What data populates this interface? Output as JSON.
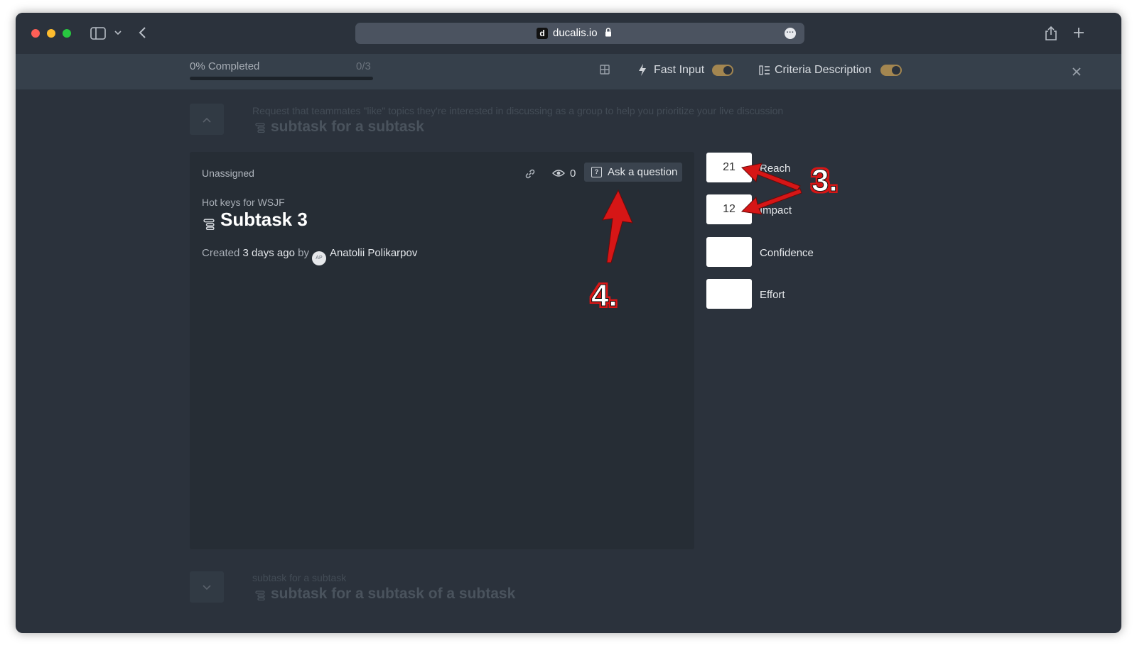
{
  "browser": {
    "site_letter": "d",
    "address": "ducalis.io"
  },
  "topbar": {
    "progress_label": "0% Completed",
    "progress_count": "0/3",
    "progress_fraction": 0,
    "fast_input_label": "Fast Input",
    "fast_input_on": true,
    "criteria_description_label": "Criteria Description",
    "criteria_description_on": true
  },
  "prev_task": {
    "description": "Request that teammates \"like\" topics they're interested in discussing as a group to help you prioritize your live discussion",
    "title": "subtask for a subtask"
  },
  "next_task": {
    "description": "subtask for a subtask",
    "title": "subtask for a subtask of a subtask"
  },
  "task": {
    "assignee": "Unassigned",
    "views": "0",
    "ask_label": "Ask a question",
    "parent": "Hot keys for WSJF",
    "title": "Subtask 3",
    "created_label": "Created",
    "created_when": "3 days ago",
    "by_label": "by",
    "author_initials": "AP",
    "author": "Anatolii Polikarpov"
  },
  "criteria": [
    {
      "name": "Reach",
      "value": "21"
    },
    {
      "name": "Impact",
      "value": "12"
    },
    {
      "name": "Confidence",
      "value": ""
    },
    {
      "name": "Effort",
      "value": ""
    }
  ],
  "annotations": {
    "step3": "3.",
    "step4": "4.",
    "color": "#d61616"
  },
  "colors": {
    "accent_toggle": "#a38650",
    "background": "#2b323c"
  }
}
